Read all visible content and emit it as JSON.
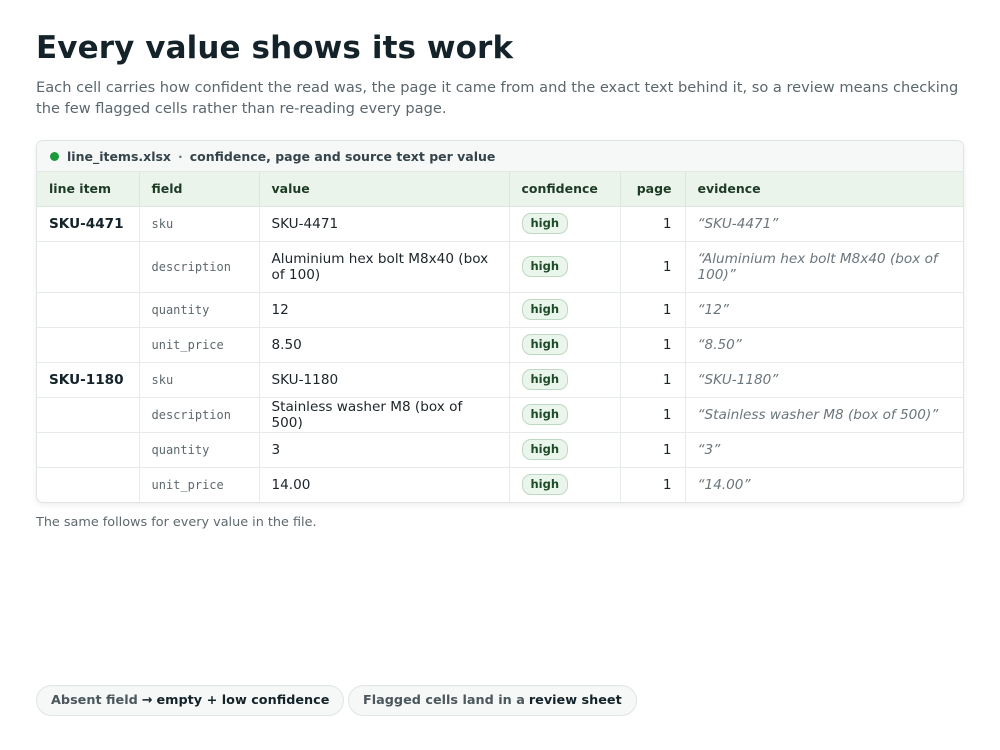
{
  "title": "Every value shows its work",
  "intro": "Each cell carries how confident the read was, the page it came from and the exact text behind it, so a review means checking the few flagged cells rather than re-reading every page.",
  "card": {
    "file_name": "line_items.xlsx",
    "separator": "·",
    "caption": "confidence, page and source text per value",
    "status_color": "#1a9a3a"
  },
  "table": {
    "columns": [
      "line item",
      "field",
      "value",
      "confidence",
      "page",
      "evidence"
    ],
    "rows": [
      {
        "item": "SKU-4471",
        "field": "sku",
        "value": "SKU-4471",
        "confidence": "high",
        "page": "1",
        "evidence": "“SKU-4471”"
      },
      {
        "item": "",
        "field": "description",
        "value": "Aluminium hex bolt M8x40 (box of 100)",
        "confidence": "high",
        "page": "1",
        "evidence": "“Aluminium hex bolt M8x40 (box of 100)”"
      },
      {
        "item": "",
        "field": "quantity",
        "value": "12",
        "confidence": "high",
        "page": "1",
        "evidence": "“12”"
      },
      {
        "item": "",
        "field": "unit_price",
        "value": "8.50",
        "confidence": "high",
        "page": "1",
        "evidence": "“8.50”"
      },
      {
        "item": "SKU-1180",
        "field": "sku",
        "value": "SKU-1180",
        "confidence": "high",
        "page": "1",
        "evidence": "“SKU-1180”"
      },
      {
        "item": "",
        "field": "description",
        "value": "Stainless washer M8 (box of 500)",
        "confidence": "high",
        "page": "1",
        "evidence": "“Stainless washer M8 (box of 500)”"
      },
      {
        "item": "",
        "field": "quantity",
        "value": "3",
        "confidence": "high",
        "page": "1",
        "evidence": "“3”"
      },
      {
        "item": "",
        "field": "unit_price",
        "value": "14.00",
        "confidence": "high",
        "page": "1",
        "evidence": "“14.00”"
      }
    ]
  },
  "footnote": "The same follows for every value in the file.",
  "pills": [
    {
      "lead": "Absent field",
      "arrow": "→",
      "strong": "empty + low confidence"
    },
    {
      "lead": "Flagged cells land in a",
      "arrow": "",
      "strong": "review sheet"
    }
  ]
}
